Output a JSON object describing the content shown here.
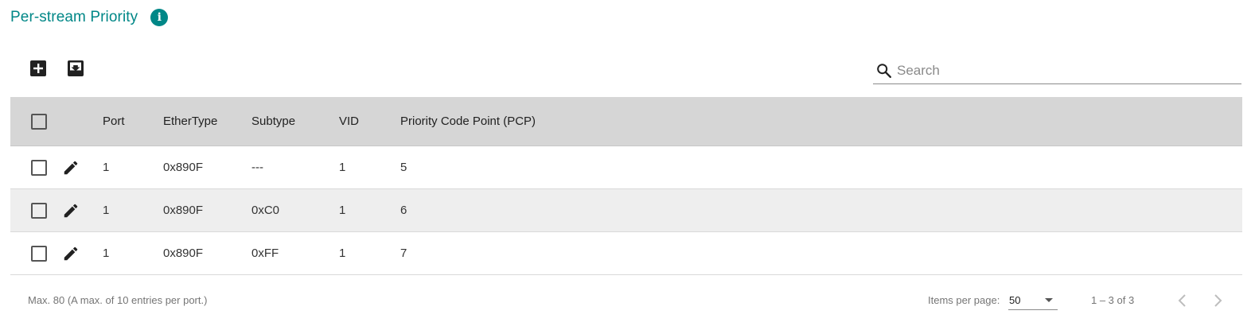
{
  "header": {
    "title": "Per-stream Priority",
    "info_icon": "info-icon"
  },
  "toolbar": {
    "add_icon": "add-box-icon",
    "import_icon": "import-icon"
  },
  "search": {
    "placeholder": "Search",
    "icon": "search-icon"
  },
  "table": {
    "columns": {
      "port": "Port",
      "ethertype": "EtherType",
      "subtype": "Subtype",
      "vid": "VID",
      "pcp": "Priority Code Point (PCP)"
    },
    "rows": [
      {
        "port": "1",
        "ethertype": "0x890F",
        "subtype": "---",
        "vid": "1",
        "pcp": "5"
      },
      {
        "port": "1",
        "ethertype": "0x890F",
        "subtype": "0xC0",
        "vid": "1",
        "pcp": "6"
      },
      {
        "port": "1",
        "ethertype": "0x890F",
        "subtype": "0xFF",
        "vid": "1",
        "pcp": "7"
      }
    ]
  },
  "footer": {
    "note": "Max. 80 (A max. of 10 entries per port.)",
    "items_per_page_label": "Items per page:",
    "items_per_page_value": "50",
    "range": "1 – 3 of 3"
  },
  "colors": {
    "accent": "#008787",
    "header_bg": "#d6d6d6",
    "alt_row_bg": "#eeeeee"
  }
}
